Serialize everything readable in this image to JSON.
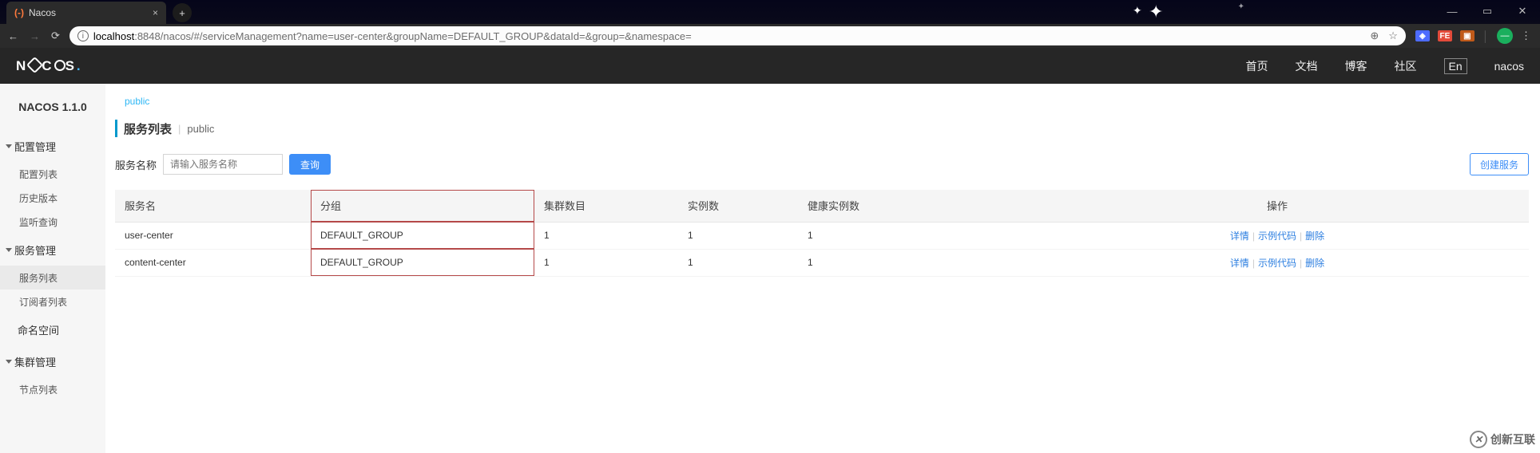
{
  "browser": {
    "tab_title": "Nacos",
    "url_host": "localhost",
    "url_port_path": ":8848/nacos/#/serviceManagement?name=user-center&groupName=DEFAULT_GROUP&dataId=&group=&namespace="
  },
  "header_nav": {
    "home": "首页",
    "docs": "文档",
    "blog": "博客",
    "community": "社区",
    "lang": "En",
    "user": "nacos"
  },
  "product_name": "NACOS 1.1.0",
  "sidebar": {
    "config": {
      "label": "配置管理",
      "items": [
        "配置列表",
        "历史版本",
        "监听查询"
      ]
    },
    "service": {
      "label": "服务管理",
      "items": [
        "服务列表",
        "订阅者列表"
      ]
    },
    "namespace": "命名空间",
    "cluster": {
      "label": "集群管理",
      "items": [
        "节点列表"
      ]
    }
  },
  "namespace_tab": "public",
  "page_title": "服务列表",
  "page_ns": "public",
  "search": {
    "label": "服务名称",
    "placeholder": "请输入服务名称",
    "btn_query": "查询",
    "btn_create": "创建服务"
  },
  "table": {
    "headers": {
      "name": "服务名",
      "group": "分组",
      "clusters": "集群数目",
      "instances": "实例数",
      "healthy": "健康实例数",
      "ops": "操作"
    },
    "rows": [
      {
        "name": "user-center",
        "group": "DEFAULT_GROUP",
        "clusters": "1",
        "instances": "1",
        "healthy": "1"
      },
      {
        "name": "content-center",
        "group": "DEFAULT_GROUP",
        "clusters": "1",
        "instances": "1",
        "healthy": "1"
      }
    ],
    "ops": {
      "detail": "详情",
      "code": "示例代码",
      "delete": "删除"
    }
  },
  "watermark": "创新互联"
}
